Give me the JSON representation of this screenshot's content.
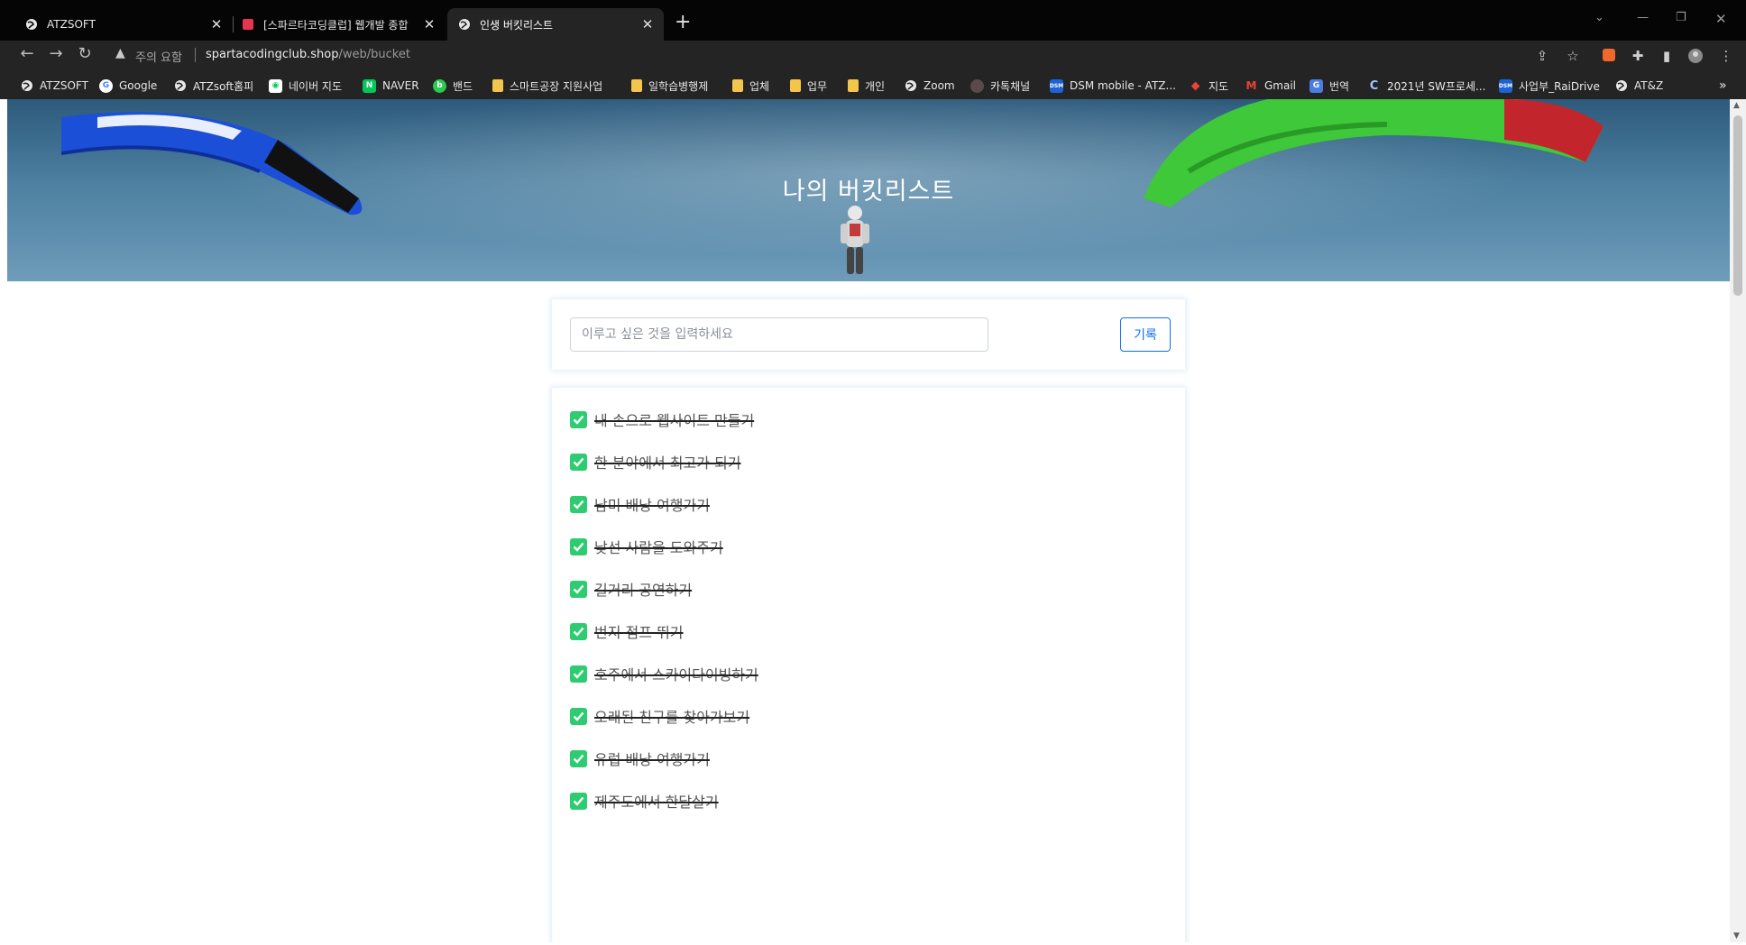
{
  "browser": {
    "tabs": [
      {
        "title": "ATZSOFT",
        "active": false
      },
      {
        "title": "[스파르타코딩클럽] 웹개발 종합",
        "active": false
      },
      {
        "title": "인생 버킷리스트",
        "active": true
      }
    ],
    "address": {
      "security_label": "주의 요함",
      "host": "spartacodingclub.shop",
      "path": "/web/bucket"
    },
    "bookmarks": [
      {
        "label": "ATZSOFT",
        "icon": "globe-icon"
      },
      {
        "label": "Google",
        "icon": "google-icon"
      },
      {
        "label": "ATZsoft홈피",
        "icon": "globe-icon"
      },
      {
        "label": "네이버 지도",
        "icon": "naver-map-icon"
      },
      {
        "label": "NAVER",
        "icon": "naver-icon"
      },
      {
        "label": "밴드",
        "icon": "band-icon"
      },
      {
        "label": "스마트공장 지원사업",
        "icon": "folder-icon"
      },
      {
        "label": "일학습병행제",
        "icon": "folder-icon"
      },
      {
        "label": "업체",
        "icon": "folder-icon"
      },
      {
        "label": "업무",
        "icon": "folder-icon"
      },
      {
        "label": "개인",
        "icon": "folder-icon"
      },
      {
        "label": "Zoom",
        "icon": "globe-icon"
      },
      {
        "label": "카톡채널",
        "icon": "kakao-icon"
      },
      {
        "label": "DSM mobile - ATZ...",
        "icon": "dsm-icon"
      },
      {
        "label": "지도",
        "icon": "google-maps-icon"
      },
      {
        "label": "Gmail",
        "icon": "gmail-icon"
      },
      {
        "label": "번역",
        "icon": "translate-icon"
      },
      {
        "label": "2021년 SW프로세...",
        "icon": "c-icon"
      },
      {
        "label": "사업부_RaiDrive",
        "icon": "dsm-icon"
      },
      {
        "label": "AT&Z",
        "icon": "globe-icon"
      }
    ],
    "overflow_label": "»"
  },
  "page": {
    "title": "나의 버킷리스트",
    "input_placeholder": "이루고 싶은 것을 입력하세요",
    "input_value": "",
    "record_button": "기록",
    "bucket_items": [
      {
        "text": "내 손으로 웹사이트 만들기",
        "done": true
      },
      {
        "text": "한 분야에서 최고가 되기",
        "done": true
      },
      {
        "text": "남미 배낭 여행가기",
        "done": true
      },
      {
        "text": "낯선 사람을 도와주기",
        "done": true
      },
      {
        "text": "길거리 공연하기",
        "done": true
      },
      {
        "text": "번지 점프 뛰기",
        "done": true
      },
      {
        "text": "호주에서 스카이다이빙하기",
        "done": true
      },
      {
        "text": "오래된 친구를 찾아가보기",
        "done": true
      },
      {
        "text": "유럽 배낭 여행가기",
        "done": true
      },
      {
        "text": "제주도에서 한달살기",
        "done": true
      }
    ]
  },
  "colors": {
    "chrome_dark": "#242424",
    "accent_blue": "#0d6efd",
    "check_green": "#2ecc71"
  }
}
